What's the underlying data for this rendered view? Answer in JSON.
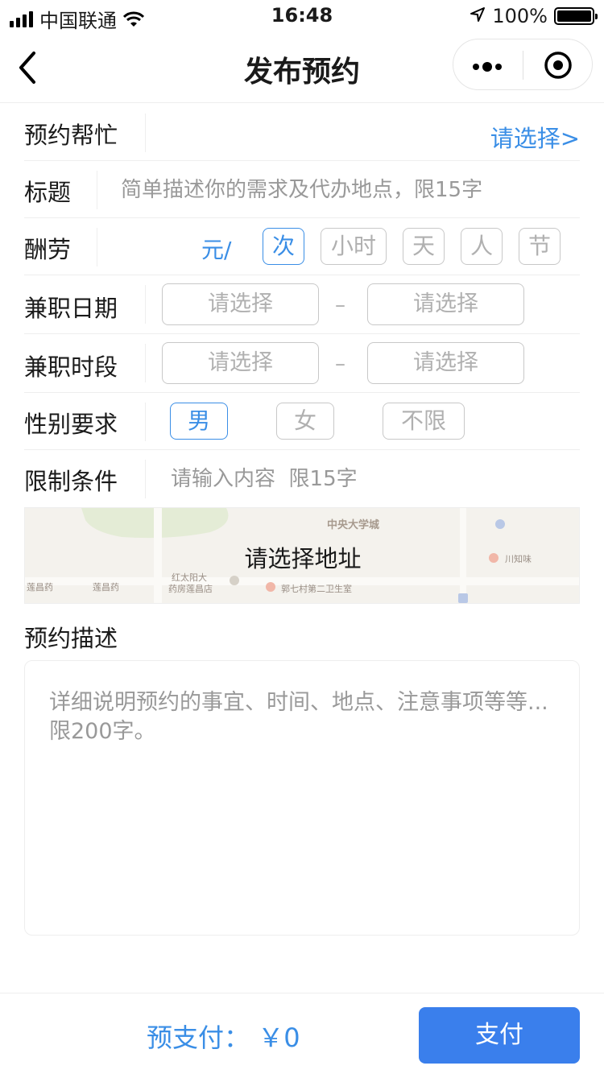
{
  "status_bar": {
    "carrier": "中国联通",
    "time": "16:48",
    "battery": "100%"
  },
  "nav": {
    "title": "发布预约"
  },
  "form": {
    "help": {
      "label": "预约帮忙",
      "action": "请选择>"
    },
    "title": {
      "label": "标题",
      "placeholder": "简单描述你的需求及代办地点，限15字"
    },
    "reward": {
      "label": "酬劳",
      "unit": "元/",
      "options": [
        "次",
        "小时",
        "天",
        "人",
        "节"
      ],
      "selected": "次"
    },
    "date": {
      "label": "兼职日期",
      "start": "请选择",
      "separator": "–",
      "end": "请选择"
    },
    "time": {
      "label": "兼职时段",
      "start": "请选择",
      "separator": "–",
      "end": "请选择"
    },
    "gender": {
      "label": "性别要求",
      "options": [
        "男",
        "女",
        "不限"
      ],
      "selected": "男"
    },
    "condition": {
      "label": "限制条件",
      "placeholder": "请输入内容  限15字"
    }
  },
  "map": {
    "label": "请选择地址",
    "pois": [
      "中央大学城",
      "川知味",
      "红太阳大",
      "药房莲昌店",
      "郭七村第二卫生室",
      "莲昌药",
      "莲昌药"
    ]
  },
  "description": {
    "title": "预约描述",
    "placeholder": "详细说明预约的事宜、时间、地点、注意事项等等...限200字。"
  },
  "bottom": {
    "prepay_label": "预支付：",
    "amount": "￥0",
    "pay_button": "支付"
  },
  "colors": {
    "accent": "#3a8ee6",
    "button": "#3a7fec",
    "muted": "#b0b0b0",
    "divider": "#eeeeee"
  }
}
